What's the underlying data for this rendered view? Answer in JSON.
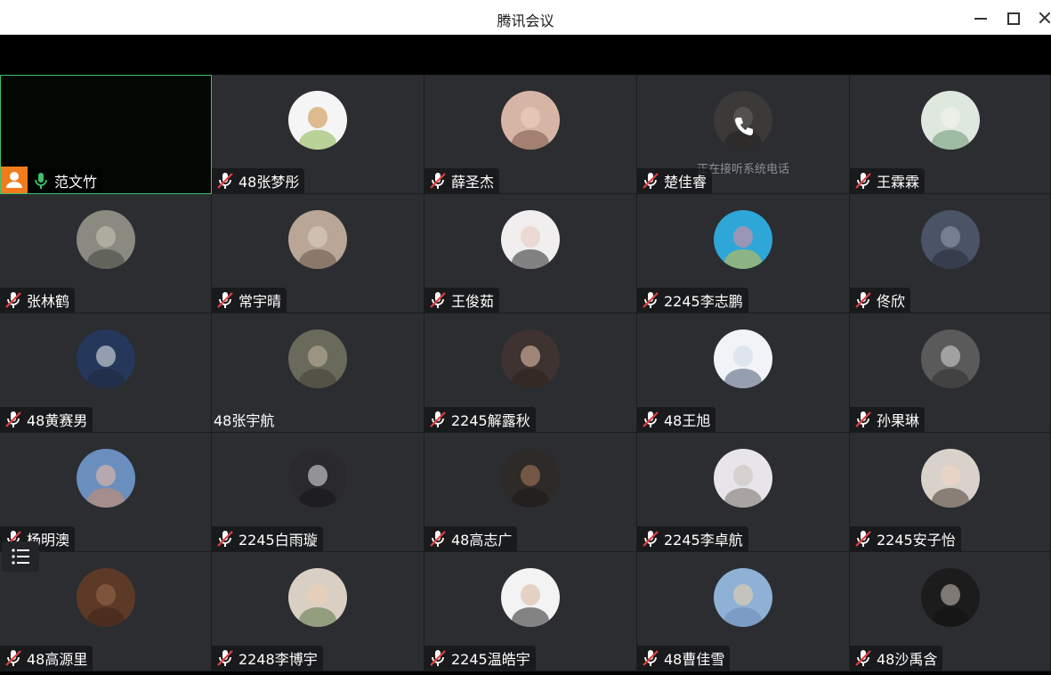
{
  "window": {
    "title": "腾讯会议"
  },
  "status_text": "正在接听系统电话",
  "participants": [
    {
      "name": "范文竹",
      "mic": "on",
      "bg": "#0a1409",
      "c1": "#0a1409",
      "c2": "#0a1409"
    },
    {
      "name": "48张梦彤",
      "mic": "muted",
      "bg": "#f5f5f5",
      "c1": "#c98a3a",
      "c2": "#7fae3c"
    },
    {
      "name": "薛圣杰",
      "mic": "muted",
      "bg": "#d7b5a5",
      "c1": "#f1d3c2",
      "c2": "#6f4b39"
    },
    {
      "name": "楚佳睿",
      "mic": "muted",
      "bg": "#3b3a38",
      "c1": "#6a6663",
      "c2": "#1f1e1d"
    },
    {
      "name": "王霖霖",
      "mic": "muted",
      "bg": "#dfe8df",
      "c1": "#f4f4ef",
      "c2": "#5e8f6a"
    },
    {
      "name": "张林鹤",
      "mic": "muted",
      "bg": "#8a8a80",
      "c1": "#c9c8b8",
      "c2": "#3a3b35"
    },
    {
      "name": "常宇晴",
      "mic": "muted",
      "bg": "#b9a696",
      "c1": "#e2d3c7",
      "c2": "#5c4a3f"
    },
    {
      "name": "王俊茹",
      "mic": "muted",
      "bg": "#f0eeee",
      "c1": "#e7c8c0",
      "c2": "#151515"
    },
    {
      "name": "2245李志鹏",
      "mic": "muted",
      "bg": "#2fa6d8",
      "c1": "#f08a9a",
      "c2": "#e9c12f"
    },
    {
      "name": "佟欣",
      "mic": "muted",
      "bg": "#4b5466",
      "c1": "#9aa3b2",
      "c2": "#222833"
    },
    {
      "name": "48黄赛男",
      "mic": "muted",
      "bg": "#25385c",
      "c1": "#f3f3f3",
      "c2": "#1d2537"
    },
    {
      "name": "48张宇航",
      "mic": "none",
      "bg": "#6a6a5c",
      "c1": "#c4b7a2",
      "c2": "#3e3a30"
    },
    {
      "name": "2245解露秋",
      "mic": "muted",
      "bg": "#3e3330",
      "c1": "#f1cbb6",
      "c2": "#2b1f1a"
    },
    {
      "name": "48王旭",
      "mic": "muted",
      "bg": "#f1f3f6",
      "c1": "#cdd9ea",
      "c2": "#3a4b6a"
    },
    {
      "name": "孙果琳",
      "mic": "muted",
      "bg": "#5a5a5a",
      "c1": "#dcdcdc",
      "c2": "#2a2a2a"
    },
    {
      "name": "杨明澳",
      "mic": "muted",
      "bg": "#6a8fbf",
      "c1": "#f3c0a3",
      "c2": "#e08a5c"
    },
    {
      "name": "2245白雨璇",
      "mic": "muted",
      "bg": "#2a2a2e",
      "c1": "#e9e9ec",
      "c2": "#111114"
    },
    {
      "name": "48高志广",
      "mic": "muted",
      "bg": "#2d2a28",
      "c1": "#b07c5e",
      "c2": "#1a1716"
    },
    {
      "name": "2245李卓航",
      "mic": "muted",
      "bg": "#e7e5ea",
      "c1": "#c9bfb6",
      "c2": "#6b6259"
    },
    {
      "name": "2245安子怡",
      "mic": "muted",
      "bg": "#d8d2ca",
      "c1": "#f4d6c4",
      "c2": "#3a2b22"
    },
    {
      "name": "48高源里",
      "mic": "muted",
      "bg": "#5d3a28",
      "c1": "#9b6a4c",
      "c2": "#3a2216"
    },
    {
      "name": "2248李博宇",
      "mic": "muted",
      "bg": "#d9d0c3",
      "c1": "#f0cdb2",
      "c2": "#4e6b3a"
    },
    {
      "name": "2245温皓宇",
      "mic": "muted",
      "bg": "#f3f3f3",
      "c1": "#d9b7a0",
      "c2": "#141414"
    },
    {
      "name": "48曹佳雪",
      "mic": "muted",
      "bg": "#8fb1d6",
      "c1": "#f3d3a7",
      "c2": "#6a86b3"
    },
    {
      "name": "48沙禹含",
      "mic": "muted",
      "bg": "#1c1c1c",
      "c1": "#d2c7bf",
      "c2": "#0f0f0f"
    }
  ],
  "icons": {
    "minimize": "minimize-icon",
    "maximize": "maximize-icon",
    "close": "close-icon",
    "mic_on": "mic-icon",
    "mic_muted": "mic-muted-icon",
    "person": "person-icon",
    "phone": "phone-icon",
    "list": "list-icon"
  },
  "colors": {
    "active_border": "#3fbf6a",
    "mic_on": "#3fbf6a",
    "mic_muted": "#e04040",
    "badge": "#f07c1d"
  }
}
